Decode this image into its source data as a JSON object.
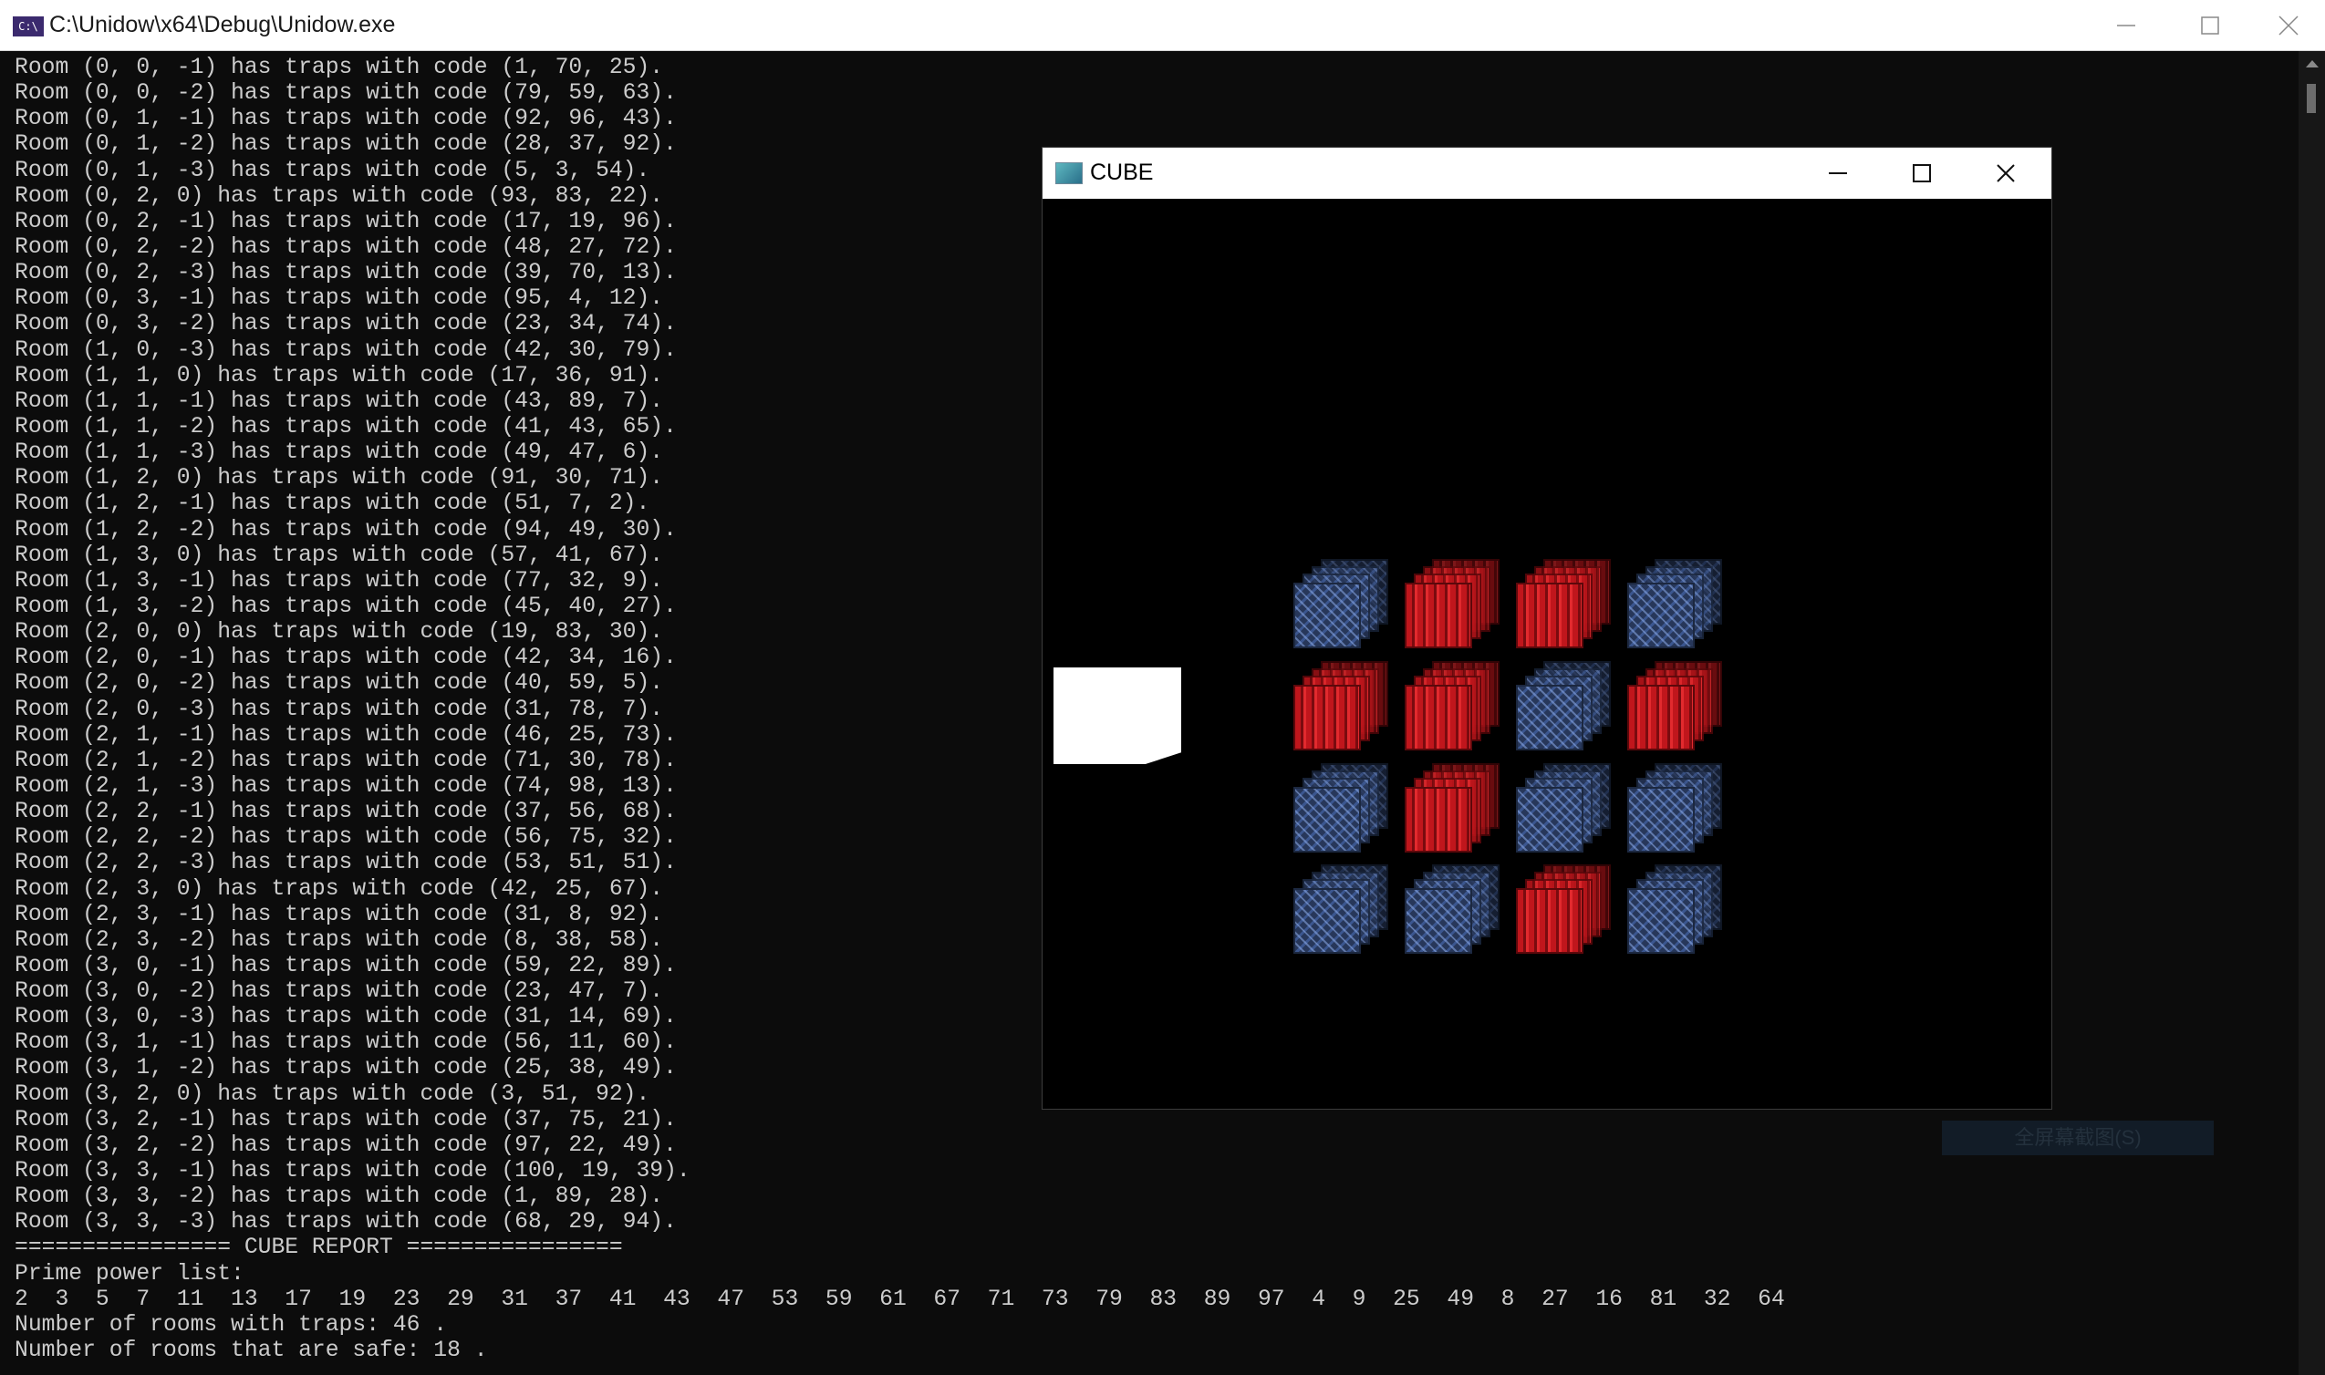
{
  "console": {
    "title": "C:\\Unidow\\x64\\Debug\\Unidow.exe",
    "app_icon_text": "C:\\",
    "lines": [
      "Room (0, 0, -1) has traps with code (1, 70, 25).",
      "Room (0, 0, -2) has traps with code (79, 59, 63).",
      "Room (0, 1, -1) has traps with code (92, 96, 43).",
      "Room (0, 1, -2) has traps with code (28, 37, 92).",
      "Room (0, 1, -3) has traps with code (5, 3, 54).",
      "Room (0, 2, 0) has traps with code (93, 83, 22).",
      "Room (0, 2, -1) has traps with code (17, 19, 96).",
      "Room (0, 2, -2) has traps with code (48, 27, 72).",
      "Room (0, 2, -3) has traps with code (39, 70, 13).",
      "Room (0, 3, -1) has traps with code (95, 4, 12).",
      "Room (0, 3, -2) has traps with code (23, 34, 74).",
      "Room (1, 0, -3) has traps with code (42, 30, 79).",
      "Room (1, 1, 0) has traps with code (17, 36, 91).",
      "Room (1, 1, -1) has traps with code (43, 89, 7).",
      "Room (1, 1, -2) has traps with code (41, 43, 65).",
      "Room (1, 1, -3) has traps with code (49, 47, 6).",
      "Room (1, 2, 0) has traps with code (91, 30, 71).",
      "Room (1, 2, -1) has traps with code (51, 7, 2).",
      "Room (1, 2, -2) has traps with code (94, 49, 30).",
      "Room (1, 3, 0) has traps with code (57, 41, 67).",
      "Room (1, 3, -1) has traps with code (77, 32, 9).",
      "Room (1, 3, -2) has traps with code (45, 40, 27).",
      "Room (2, 0, 0) has traps with code (19, 83, 30).",
      "Room (2, 0, -1) has traps with code (42, 34, 16).",
      "Room (2, 0, -2) has traps with code (40, 59, 5).",
      "Room (2, 0, -3) has traps with code (31, 78, 7).",
      "Room (2, 1, -1) has traps with code (46, 25, 73).",
      "Room (2, 1, -2) has traps with code (71, 30, 78).",
      "Room (2, 1, -3) has traps with code (74, 98, 13).",
      "Room (2, 2, -1) has traps with code (37, 56, 68).",
      "Room (2, 2, -2) has traps with code (56, 75, 32).",
      "Room (2, 2, -3) has traps with code (53, 51, 51).",
      "Room (2, 3, 0) has traps with code (42, 25, 67).",
      "Room (2, 3, -1) has traps with code (31, 8, 92).",
      "Room (2, 3, -2) has traps with code (8, 38, 58).",
      "Room (3, 0, -1) has traps with code (59, 22, 89).",
      "Room (3, 0, -2) has traps with code (23, 47, 7).",
      "Room (3, 0, -3) has traps with code (31, 14, 69).",
      "Room (3, 1, -1) has traps with code (56, 11, 60).",
      "Room (3, 1, -2) has traps with code (25, 38, 49).",
      "Room (3, 2, 0) has traps with code (3, 51, 92).",
      "Room (3, 2, -1) has traps with code (37, 75, 21).",
      "Room (3, 2, -2) has traps with code (97, 22, 49).",
      "Room (3, 3, -1) has traps with code (100, 19, 39).",
      "Room (3, 3, -2) has traps with code (1, 89, 28).",
      "Room (3, 3, -3) has traps with code (68, 29, 94).",
      "================ CUBE REPORT ================",
      "Prime power list:",
      "2  3  5  7  11  13  17  19  23  29  31  37  41  43  47  53  59  61  67  71  73  79  83  89  97  4  9  25  49  8  27  16  81  32  64",
      "Number of rooms with traps: 46 .",
      "Number of rooms that are safe: 18 ."
    ]
  },
  "cube_window": {
    "title": "CUBE",
    "grid_colors": [
      [
        "blue",
        "red",
        "red",
        "blue"
      ],
      [
        "red",
        "red",
        "blue",
        "red"
      ],
      [
        "blue",
        "red",
        "blue",
        "blue"
      ],
      [
        "blue",
        "blue",
        "red",
        "blue"
      ]
    ],
    "colors": {
      "red": "#c0161c",
      "blue": "#3b568f"
    }
  },
  "background_button": {
    "label": "全屏幕截图(S)"
  }
}
